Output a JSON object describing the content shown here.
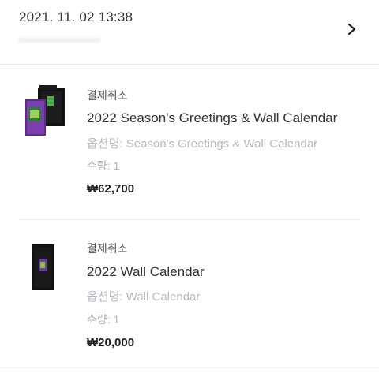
{
  "order": {
    "date": "2021. 11. 02 13:38",
    "order_number": "r•••••••••••••••••••"
  },
  "items": [
    {
      "status": "결제취소",
      "title": "2022 Season's Greetings & Wall Calendar",
      "option": "옵션명: Season's Greetings & Wall Calendar",
      "quantity": "수량: 1",
      "price": "₩62,700"
    },
    {
      "status": "결제취소",
      "title": "2022 Wall Calendar",
      "option": "옵션명: Wall Calendar",
      "quantity": "수량: 1",
      "price": "₩20,000"
    }
  ],
  "colors": {
    "option_text": "#b9b9c2",
    "thumb_accent": "#6b3fa0",
    "thumb_dark": "#111111"
  },
  "icons": {
    "header": "chevron-right-icon"
  }
}
